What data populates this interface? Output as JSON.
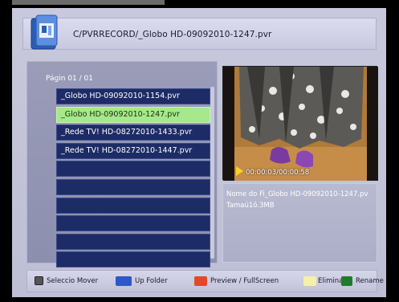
{
  "header": {
    "path": "C/PVRRECORD/_Globo HD-09092010-1247.pvr"
  },
  "left": {
    "page_label": "Págin 01 / 01",
    "files": [
      "_Globo HD-09092010-1154.pvr",
      "_Globo HD-09092010-1247.pvr",
      "_Rede TV! HD-08272010-1433.pvr",
      "_Rede TV! HD-08272010-1447.pvr",
      "",
      "",
      "",
      "",
      "",
      ""
    ],
    "selected_index": 1
  },
  "preview": {
    "time": "00:00:03/00:00:58"
  },
  "info": {
    "name": "Nome do Fi_Globo HD-09092010-1247.pv",
    "size": "Tamaú1ö.3MB"
  },
  "footer": {
    "select_move": "Seleccio  Mover",
    "up_folder": "Up Folder",
    "preview_fullscreen": "Preview / FullScreen",
    "delete": "Eliminar",
    "rename": "Rename"
  },
  "colors": {
    "list_row": "#1d2b66",
    "selected_row": "#a6e88a",
    "blue_key": "#2e57c7",
    "red_key": "#e2492a",
    "yellow_key": "#f5f0a8",
    "green_key": "#1f7a2c"
  }
}
